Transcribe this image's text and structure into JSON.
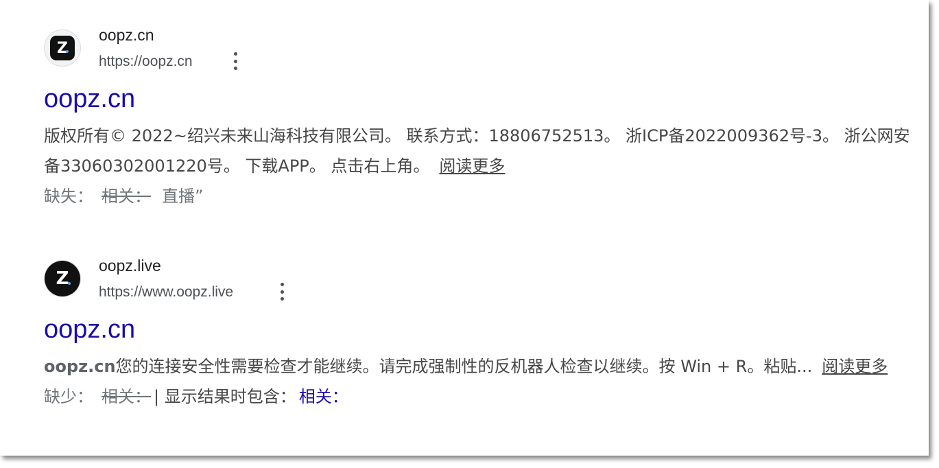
{
  "results": [
    {
      "site_name": "oopz.cn",
      "url": "https://oopz.cn",
      "favicon_text": "Z",
      "title": "oopz.cn",
      "snippet": "版权所有© 2022~绍兴未来山海科技有限公司。 联系方式：18806752513。 浙ICP备2022009362号-3。 浙公网安备33060302001220号。 下载APP。 点击右上角。",
      "read_more": "阅读更多",
      "missing_label": "缺失：",
      "missing_struck": "相关：",
      "missing_extra": "直播”"
    },
    {
      "site_name": "oopz.live",
      "url": "https://www.oopz.live",
      "favicon_text": "Z",
      "title": "oopz.cn",
      "snippet_bold": "oopz.cn",
      "snippet": "您的连接安全性需要检查才能继续。请完成强制性的反机器人检查以继续。按 Win + R。粘贴...",
      "read_more": "阅读更多",
      "missing_label": "缺少：",
      "missing_struck": "相关：",
      "include_prefix": "| 显示结果时包含：",
      "include_link": "相关："
    }
  ],
  "colors": {
    "link": "#1a0dab",
    "text": "#474747",
    "site_name": "#202124",
    "url": "#4d5156"
  },
  "icons": [
    "oopz-logo-icon",
    "more-vert-icon"
  ]
}
